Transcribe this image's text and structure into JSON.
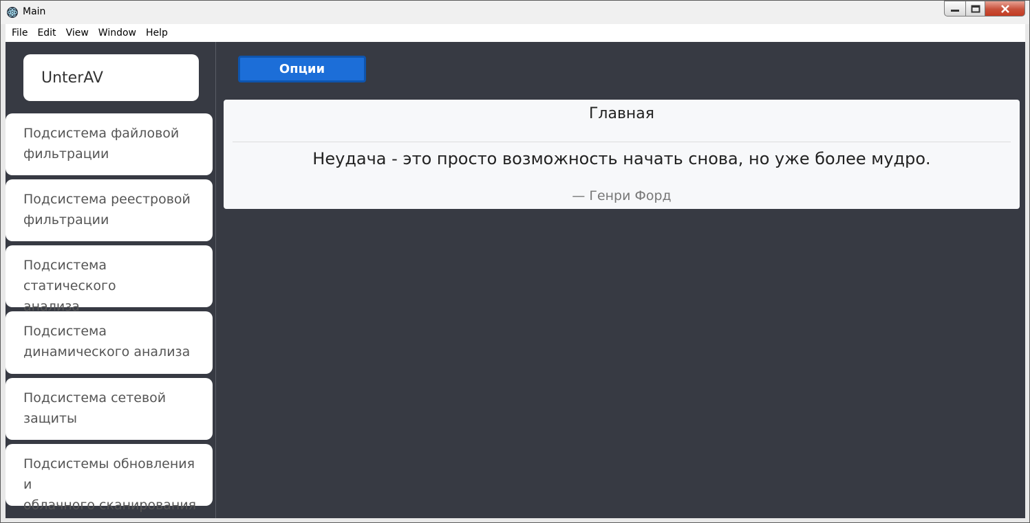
{
  "window": {
    "title": "Main"
  },
  "menubar": {
    "items": [
      "File",
      "Edit",
      "View",
      "Window",
      "Help"
    ]
  },
  "sidebar": {
    "brand": "UnterAV",
    "items": [
      {
        "line1": "Подсистема файловой",
        "line2": "фильтрации"
      },
      {
        "line1": "Подсистема реестровой",
        "line2": "фильтрации"
      },
      {
        "line1": "Подсистема статического",
        "line2": "анализа"
      },
      {
        "line1": "Подсистема",
        "line2": "динамического анализа"
      },
      {
        "line1": "Подсистема сетевой",
        "line2": "защиты"
      },
      {
        "line1": "Подсистемы обновления и",
        "line2": "облачного сканирования"
      }
    ]
  },
  "main": {
    "options_label": "Опции",
    "card": {
      "title": "Главная",
      "quote": "Неудача - это просто возможность начать снова, но уже более мудро.",
      "author": "— Генри Форд"
    }
  },
  "colors": {
    "app_bg": "#373a43",
    "accent": "#1c6ed8",
    "close_button": "#c7503a"
  }
}
